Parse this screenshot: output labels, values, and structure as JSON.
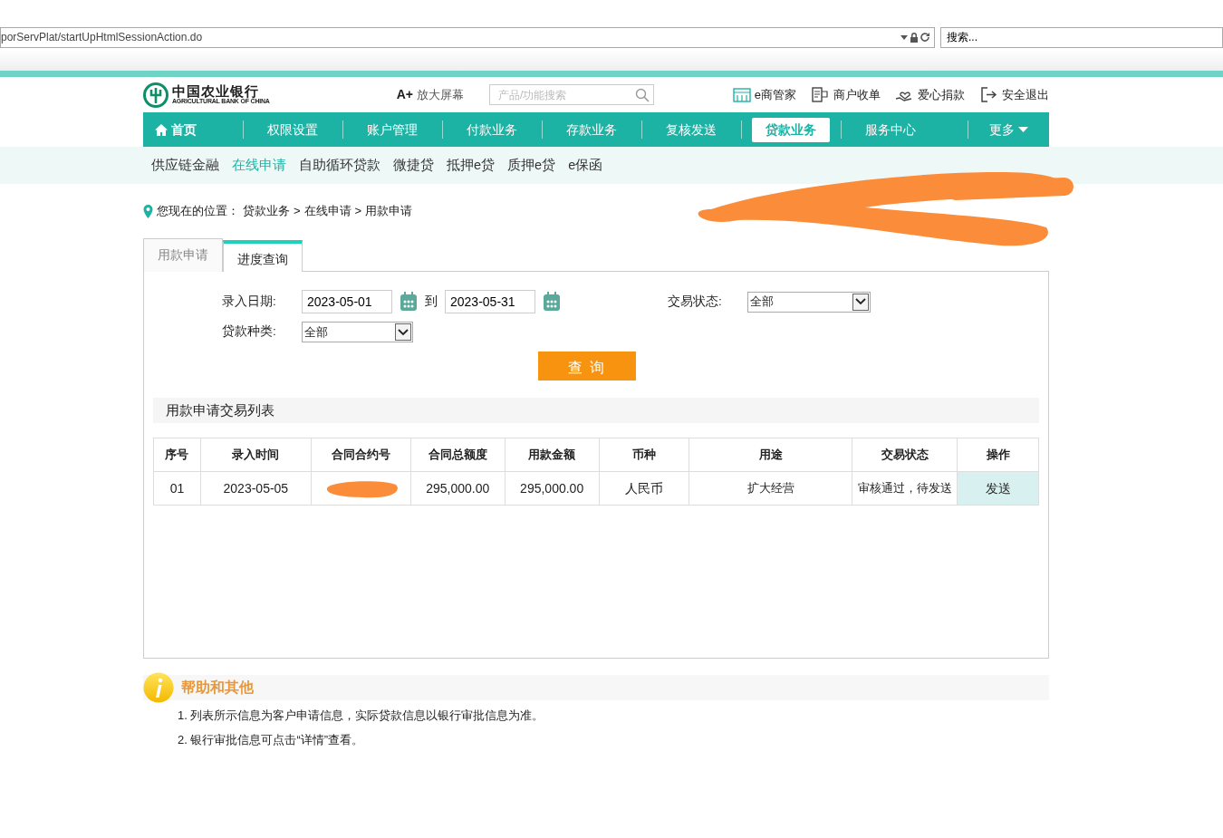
{
  "browser": {
    "address": "porServPlat/startUpHtmlSessionAction.do",
    "search_placeholder": "搜索..."
  },
  "header": {
    "logo_name": "中国农业银行",
    "logo_sub": "AGRICULTURAL BANK OF CHINA",
    "zoom": {
      "mark": "A+",
      "label": "放大屏幕"
    },
    "search_placeholder": "产品/功能搜索",
    "links": [
      {
        "kind": "shop",
        "label": "e商管家"
      },
      {
        "kind": "receipt",
        "label": "商户收单"
      },
      {
        "kind": "heart",
        "label": "爱心捐款"
      },
      {
        "kind": "exit",
        "label": "安全退出"
      }
    ]
  },
  "main_nav": {
    "items": [
      {
        "label": "首页",
        "home": true,
        "selected": false
      },
      {
        "label": "权限设置",
        "home": false,
        "selected": false
      },
      {
        "label": "账户管理",
        "home": false,
        "selected": false
      },
      {
        "label": "付款业务",
        "home": false,
        "selected": false
      },
      {
        "label": "存款业务",
        "home": false,
        "selected": false
      },
      {
        "label": "复核发送",
        "home": false,
        "selected": false
      },
      {
        "label": "贷款业务",
        "home": false,
        "selected": true
      },
      {
        "label": "服务中心",
        "home": false,
        "selected": false
      }
    ],
    "more": "更多"
  },
  "sub_nav": {
    "items": [
      {
        "label": "供应链金融",
        "selected": false
      },
      {
        "label": "在线申请",
        "selected": true
      },
      {
        "label": "自助循环贷款",
        "selected": false
      },
      {
        "label": "微捷贷",
        "selected": false
      },
      {
        "label": "抵押e贷",
        "selected": false
      },
      {
        "label": "质押e贷",
        "selected": false
      },
      {
        "label": "e保函",
        "selected": false
      }
    ]
  },
  "breadcrumb": {
    "label": "您现在的位置：",
    "items": [
      "贷款业务",
      "在线申请",
      "用款申请"
    ],
    "separator": ">"
  },
  "tabs": [
    {
      "label": "用款申请",
      "selected": false
    },
    {
      "label": "进度查询",
      "selected": true
    }
  ],
  "filters": {
    "date_label": "录入日期:",
    "date_from": "2023-05-01",
    "to": "到",
    "date_to": "2023-05-31",
    "status_label": "交易状态:",
    "status_value": "全部",
    "type_label": "贷款种类:",
    "type_value": "全部",
    "query_button": "查 询"
  },
  "table": {
    "title": "用款申请交易列表",
    "columns": [
      "序号",
      "录入时间",
      "合同合约号",
      "合同总额度",
      "用款金额",
      "币种",
      "用途",
      "交易状态",
      "操作"
    ],
    "rows": [
      {
        "cells": [
          "01",
          "2023-05-05",
          "",
          "295,000.00",
          "295,000.00",
          "人民币",
          "扩大经营",
          "审核通过，待发送"
        ],
        "action": "发送"
      }
    ]
  },
  "help": {
    "title": "帮助和其他",
    "items": [
      "1.  列表所示信息为客户申请信息，实际贷款信息以银行审批信息为准。",
      "2.  银行审批信息可点击“详情”查看。"
    ]
  }
}
